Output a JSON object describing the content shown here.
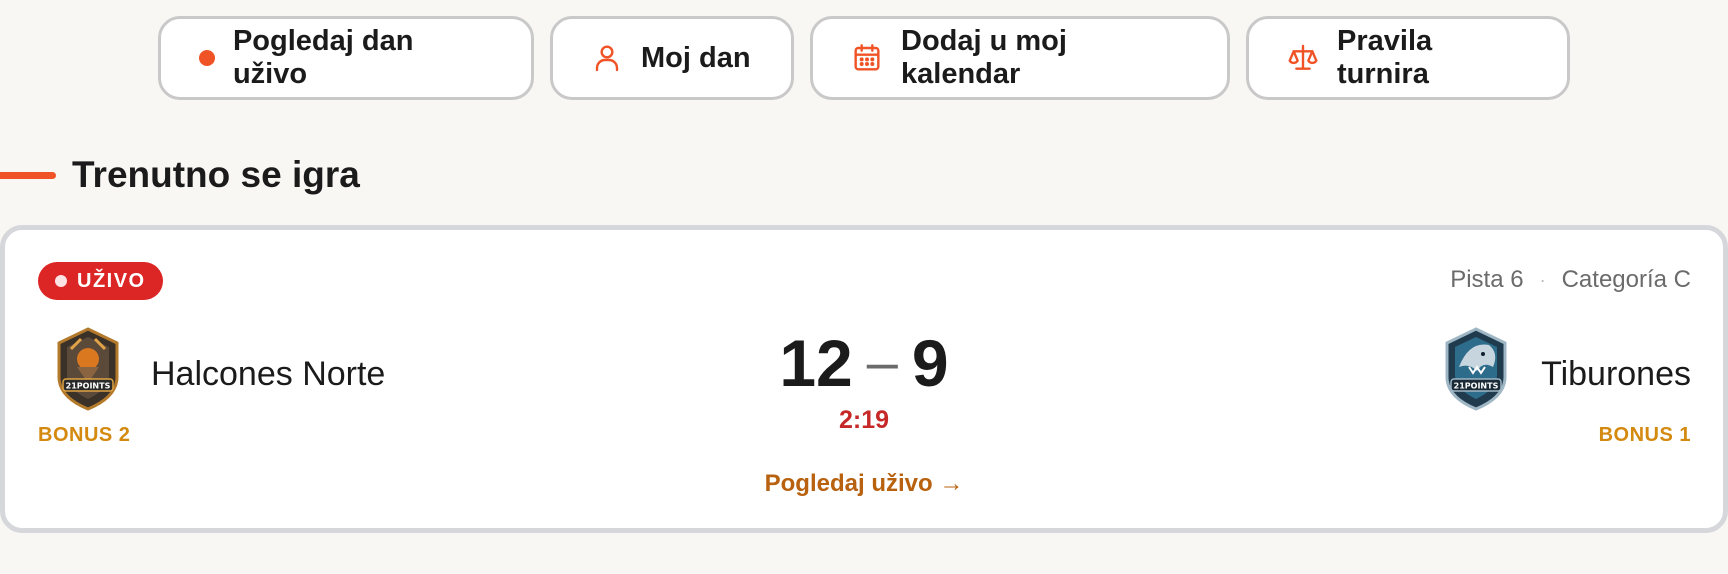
{
  "actions": [
    {
      "label": "Pogledaj dan uživo",
      "icon": "live-dot-icon"
    },
    {
      "label": "Moj dan",
      "icon": "user-icon"
    },
    {
      "label": "Dodaj u moj kalendar",
      "icon": "calendar-icon"
    },
    {
      "label": "Pravila turnira",
      "icon": "scale-icon"
    }
  ],
  "section": {
    "title": "Trenutno se igra"
  },
  "match": {
    "status": "UŽIVO",
    "court": "Pista 6",
    "category": "Categoría C",
    "home": {
      "name": "Halcones Norte",
      "bonus": "BONUS 2",
      "score": "12"
    },
    "away": {
      "name": "Tiburones",
      "bonus": "BONUS 1",
      "score": "9"
    },
    "score_separator": "–",
    "clock": "2:19",
    "watch_label": "Pogledaj uživo →"
  },
  "colors": {
    "accent": "#f05326",
    "live": "#dc2626",
    "bonus": "#d4890f",
    "link": "#b8610f",
    "clock": "#c62828"
  }
}
